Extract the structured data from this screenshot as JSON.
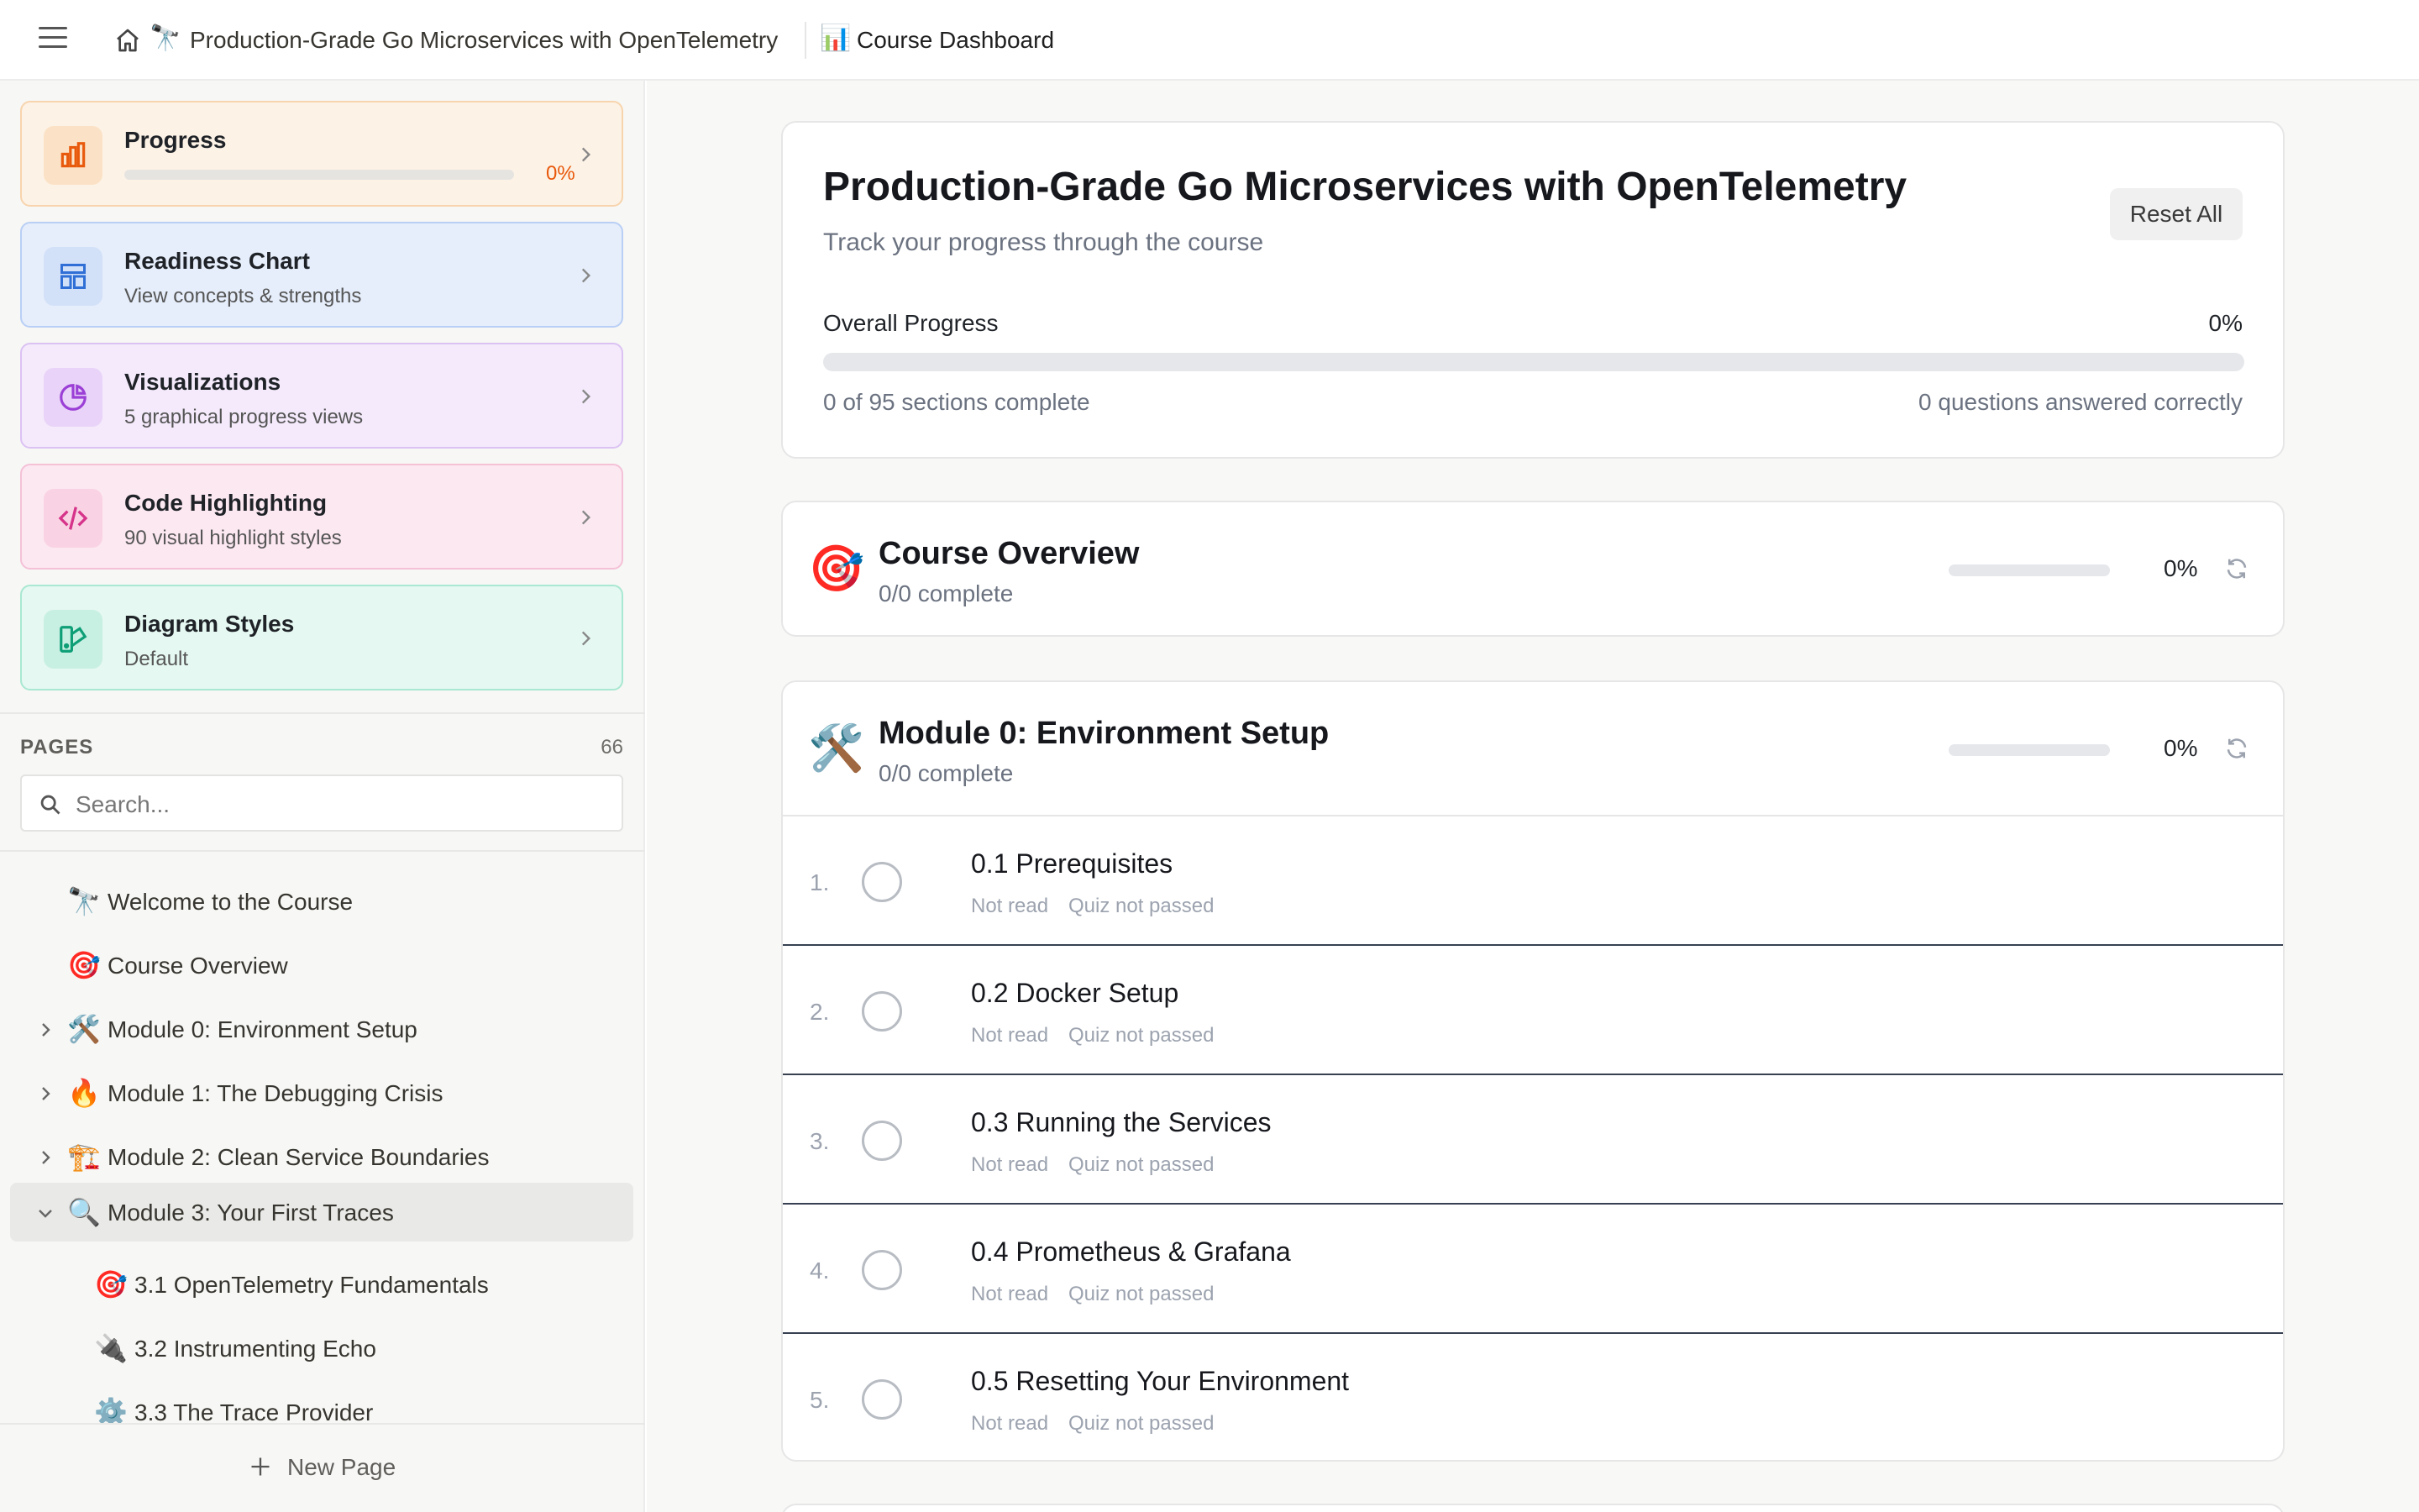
{
  "topbar": {
    "breadcrumb_emoji": "🔭",
    "breadcrumb_title": "Production-Grade Go Microservices with OpenTelemetry",
    "page_emoji": "📊",
    "page_title": "Course Dashboard"
  },
  "sidebar": {
    "cards": {
      "progress": {
        "title": "Progress",
        "value": "0%",
        "fraction": 0,
        "icon": "bar-chart-icon"
      },
      "readiness": {
        "title": "Readiness Chart",
        "subtitle": "View concepts & strengths",
        "icon": "layout-icon"
      },
      "visualizations": {
        "title": "Visualizations",
        "subtitle": "5 graphical progress views",
        "icon": "pie-chart-icon"
      },
      "code": {
        "title": "Code Highlighting",
        "subtitle": "90 visual highlight styles",
        "icon": "code-icon"
      },
      "diagram": {
        "title": "Diagram Styles",
        "subtitle": "Default",
        "icon": "palette-icon"
      }
    },
    "pages_label": "PAGES",
    "pages_count": "66",
    "search_placeholder": "Search...",
    "tree": [
      {
        "emoji": "🔭",
        "label": "Welcome to the Course"
      },
      {
        "emoji": "🎯",
        "label": "Course Overview"
      },
      {
        "emoji": "🛠️",
        "label": "Module 0: Environment Setup"
      },
      {
        "emoji": "🔥",
        "label": "Module 1: The Debugging Crisis"
      },
      {
        "emoji": "🏗️",
        "label": "Module 2: Clean Service Boundaries"
      },
      {
        "emoji": "🔍",
        "label": "Module 3: Your First Traces"
      },
      {
        "emoji": "🎯",
        "label": "3.1 OpenTelemetry Fundamentals"
      },
      {
        "emoji": "🔌",
        "label": "3.2 Instrumenting Echo"
      },
      {
        "emoji": "⚙️",
        "label": "3.3 The Trace Provider"
      }
    ],
    "new_page_label": "New Page"
  },
  "summary": {
    "title": "Production-Grade Go Microservices with OpenTelemetry",
    "subtitle": "Track your progress through the course",
    "reset_label": "Reset All",
    "overall_label": "Overall Progress",
    "overall_value": "0%",
    "overall_fraction": 0,
    "sections_text": "0 of 95 sections complete",
    "questions_text": "0 questions answered correctly"
  },
  "modules": {
    "overview": {
      "emoji": "🎯",
      "title": "Course Overview",
      "subtitle": "0/0 complete",
      "value": "0%",
      "fraction": 0
    },
    "module0": {
      "emoji": "🛠️",
      "title": "Module 0: Environment Setup",
      "subtitle": "0/0 complete",
      "value": "0%",
      "fraction": 0
    }
  },
  "lessons": [
    {
      "num": "1.",
      "title": "0.1 Prerequisites",
      "read": "Not read",
      "quiz": "Quiz not passed"
    },
    {
      "num": "2.",
      "title": "0.2 Docker Setup",
      "read": "Not read",
      "quiz": "Quiz not passed"
    },
    {
      "num": "3.",
      "title": "0.3 Running the Services",
      "read": "Not read",
      "quiz": "Quiz not passed"
    },
    {
      "num": "4.",
      "title": "0.4 Prometheus & Grafana",
      "read": "Not read",
      "quiz": "Quiz not passed"
    },
    {
      "num": "5.",
      "title": "0.5 Resetting Your Environment",
      "read": "Not read",
      "quiz": "Quiz not passed"
    }
  ],
  "colors": {
    "accent": "#3b82f6",
    "progress_orange": "#e8590c",
    "readiness_blue": "#2f6fd6",
    "viz_purple": "#9b3fd6",
    "code_pink": "#d6338a",
    "diagram_teal": "#0e9f77"
  }
}
